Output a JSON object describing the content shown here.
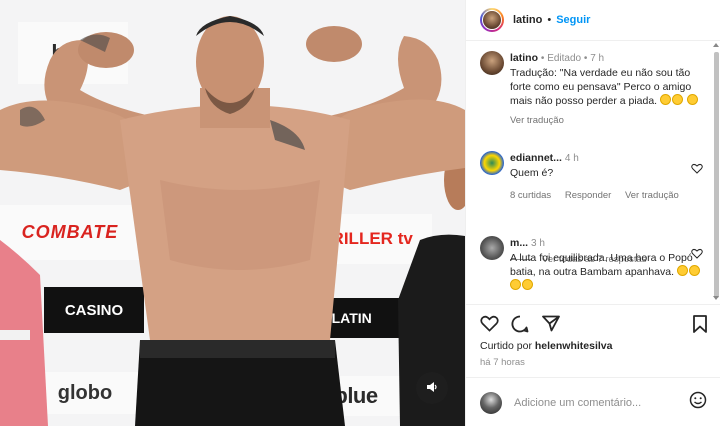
{
  "post": {
    "author": "latino",
    "follow_label": "Seguir",
    "caption_author": "latino",
    "caption_edited": "Editado",
    "caption_time": "7 h",
    "caption_text": "Tradução: \"Na verdade eu não sou tão forte como eu pensava\" Perco o amigo mais não posso perder a piada.",
    "see_translation": "Ver tradução",
    "likes_prefix": "Curtido por",
    "likes_user": "helenwhitesilva",
    "posted_ago": "há 7 horas"
  },
  "comments": [
    {
      "user": "ediannet...",
      "time": "4 h",
      "text": "Quem é?",
      "likes": "8 curtidas",
      "reply": "Responder",
      "translate": "Ver tradução",
      "view_replies": "Ver todas as 7 respostas"
    },
    {
      "user": "m...",
      "time": "3 h",
      "text": "A luta foi equilibrada. Uma hora o Popó batia, na outra Bambam apanhava."
    }
  ],
  "composer": {
    "placeholder": "Adicione um comentário..."
  },
  "media": {
    "sponsors": [
      "blue",
      "COMBATE",
      "TRILLER",
      "tv",
      "CASINO",
      "PLATIN",
      "globo",
      "blue"
    ]
  },
  "colors": {
    "link": "#0095f6",
    "text": "#262626",
    "muted": "#8e8e8e"
  },
  "icons": [
    "heart-icon",
    "comment-icon",
    "share-icon",
    "save-icon",
    "sound-icon",
    "emoji-icon"
  ]
}
